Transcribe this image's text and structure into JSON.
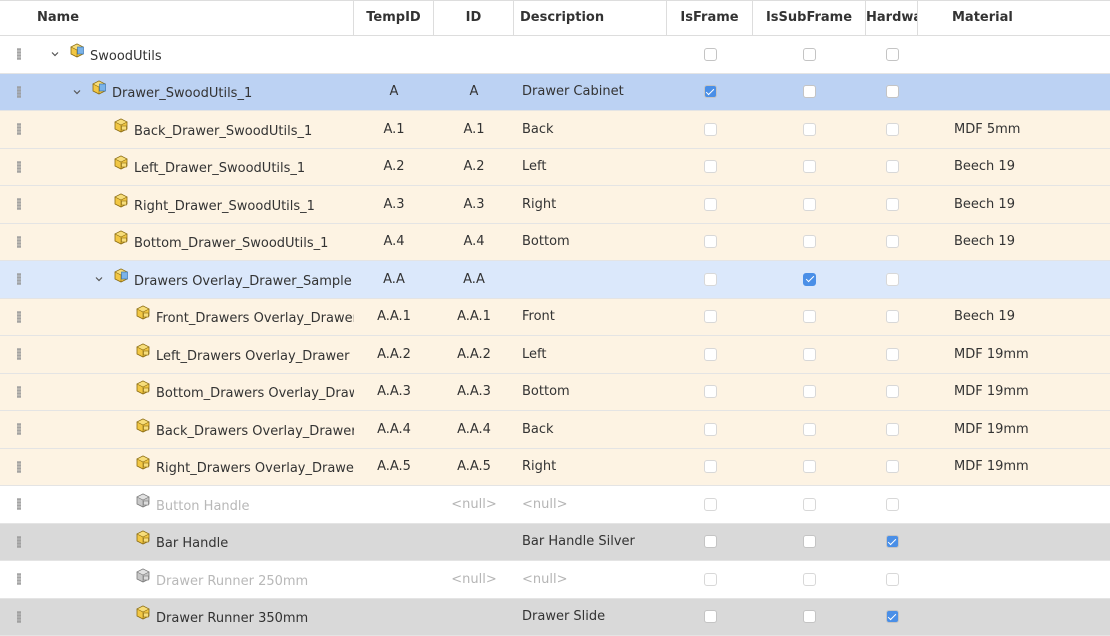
{
  "columns": {
    "name": "Name",
    "temp_id": "TempID",
    "id": "ID",
    "description": "Description",
    "is_frame": "IsFrame",
    "is_sub_frame": "IsSubFrame",
    "hardware": "Hardware",
    "material": "Material"
  },
  "colors": {
    "selected_row": "#bcd2f3",
    "subframe_row": "#dbe8fb",
    "part_row": "#fdf3e3",
    "hardware_row": "#d9d9d9",
    "default_row": "#ffffff",
    "checkbox_checked": "#4a8fe7"
  },
  "rows": [
    {
      "level": 0,
      "expander": true,
      "icon": "assembly-cube-icon",
      "name": "SwoodUtils",
      "temp_id": "",
      "id": "",
      "description": "",
      "is_frame": false,
      "is_sub_frame": false,
      "hardware": false,
      "material": "",
      "type": "root"
    },
    {
      "level": 1,
      "expander": true,
      "icon": "assembly-cube-icon",
      "name": "Drawer_SwoodUtils_1",
      "temp_id": "A",
      "id": "A",
      "description": "Drawer Cabinet",
      "is_frame": true,
      "is_sub_frame": false,
      "hardware": false,
      "material": "",
      "type": "selected"
    },
    {
      "level": 2,
      "expander": false,
      "icon": "part-cube-icon",
      "name": "Back_Drawer_SwoodUtils_1",
      "temp_id": "A.1",
      "id": "A.1",
      "description": "Back",
      "is_frame": false,
      "is_sub_frame": false,
      "hardware": false,
      "material": "MDF 5mm",
      "type": "part"
    },
    {
      "level": 2,
      "expander": false,
      "icon": "part-cube-icon",
      "name": "Left_Drawer_SwoodUtils_1",
      "temp_id": "A.2",
      "id": "A.2",
      "description": "Left",
      "is_frame": false,
      "is_sub_frame": false,
      "hardware": false,
      "material": "Beech 19",
      "type": "part"
    },
    {
      "level": 2,
      "expander": false,
      "icon": "part-cube-icon",
      "name": "Right_Drawer_SwoodUtils_1",
      "temp_id": "A.3",
      "id": "A.3",
      "description": "Right",
      "is_frame": false,
      "is_sub_frame": false,
      "hardware": false,
      "material": "Beech 19",
      "type": "part"
    },
    {
      "level": 2,
      "expander": false,
      "icon": "part-cube-icon",
      "name": "Bottom_Drawer_SwoodUtils_1",
      "temp_id": "A.4",
      "id": "A.4",
      "description": "Bottom",
      "is_frame": false,
      "is_sub_frame": false,
      "hardware": false,
      "material": "Beech 19",
      "type": "part"
    },
    {
      "level": 2,
      "expander": true,
      "icon": "assembly-cube-icon",
      "name": "Drawers Overlay_Drawer_Sample",
      "temp_id": "A.A",
      "id": "A.A",
      "description": "",
      "is_frame": false,
      "is_sub_frame": true,
      "hardware": false,
      "material": "",
      "type": "subframe"
    },
    {
      "level": 3,
      "expander": false,
      "icon": "part-cube-icon",
      "name": "Front_Drawers Overlay_Drawer",
      "temp_id": "A.A.1",
      "id": "A.A.1",
      "description": "Front",
      "is_frame": false,
      "is_sub_frame": false,
      "hardware": false,
      "material": "Beech 19",
      "type": "part"
    },
    {
      "level": 3,
      "expander": false,
      "icon": "part-cube-icon",
      "name": "Left_Drawers Overlay_Drawer",
      "temp_id": "A.A.2",
      "id": "A.A.2",
      "description": "Left",
      "is_frame": false,
      "is_sub_frame": false,
      "hardware": false,
      "material": "MDF 19mm",
      "type": "part"
    },
    {
      "level": 3,
      "expander": false,
      "icon": "part-cube-icon",
      "name": "Bottom_Drawers Overlay_Drawer",
      "temp_id": "A.A.3",
      "id": "A.A.3",
      "description": "Bottom",
      "is_frame": false,
      "is_sub_frame": false,
      "hardware": false,
      "material": "MDF 19mm",
      "type": "part"
    },
    {
      "level": 3,
      "expander": false,
      "icon": "part-cube-icon",
      "name": "Back_Drawers Overlay_Drawer",
      "temp_id": "A.A.4",
      "id": "A.A.4",
      "description": "Back",
      "is_frame": false,
      "is_sub_frame": false,
      "hardware": false,
      "material": "MDF 19mm",
      "type": "part"
    },
    {
      "level": 3,
      "expander": false,
      "icon": "part-cube-icon",
      "name": "Right_Drawers Overlay_Drawer",
      "temp_id": "A.A.5",
      "id": "A.A.5",
      "description": "Right",
      "is_frame": false,
      "is_sub_frame": false,
      "hardware": false,
      "material": "MDF 19mm",
      "type": "part"
    },
    {
      "level": 3,
      "expander": false,
      "icon": "grey-part-cube-icon",
      "name": "Button Handle",
      "temp_id": "",
      "id": "<null>",
      "description": "<null>",
      "is_frame": false,
      "is_sub_frame": false,
      "hardware": false,
      "material": "",
      "type": "disabled"
    },
    {
      "level": 3,
      "expander": false,
      "icon": "part-cube-icon",
      "name": "Bar Handle",
      "temp_id": "",
      "id": "",
      "description": "Bar Handle Silver",
      "is_frame": false,
      "is_sub_frame": false,
      "hardware": true,
      "material": "",
      "type": "hardware"
    },
    {
      "level": 3,
      "expander": false,
      "icon": "grey-part-cube-icon",
      "name": "Drawer Runner 250mm",
      "temp_id": "",
      "id": "<null>",
      "description": "<null>",
      "is_frame": false,
      "is_sub_frame": false,
      "hardware": false,
      "material": "",
      "type": "disabled"
    },
    {
      "level": 3,
      "expander": false,
      "icon": "part-cube-icon",
      "name": "Drawer Runner 350mm",
      "temp_id": "",
      "id": "",
      "description": "Drawer Slide",
      "is_frame": false,
      "is_sub_frame": false,
      "hardware": true,
      "material": "",
      "type": "hardware"
    }
  ]
}
